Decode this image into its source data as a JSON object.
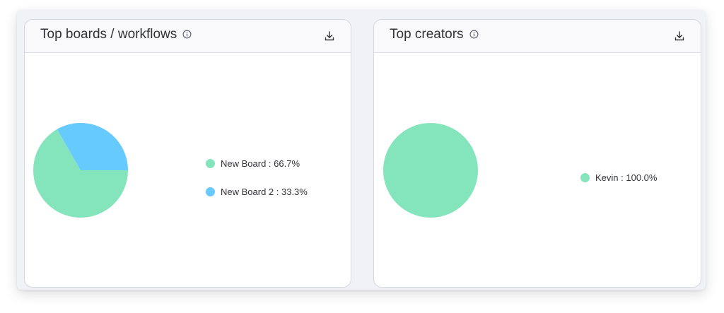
{
  "widgets": [
    {
      "title": "Top boards / workflows",
      "info_icon": "info-icon",
      "download_icon": "download-icon"
    },
    {
      "title": "Top creators",
      "info_icon": "info-icon",
      "download_icon": "download-icon"
    }
  ],
  "colors": {
    "green": "#84e5bd",
    "blue": "#67cafd"
  },
  "chart_data": [
    {
      "type": "pie",
      "title": "Top boards / workflows",
      "categories": [
        "New Board",
        "New Board 2"
      ],
      "values": [
        66.7,
        33.3
      ],
      "colors": [
        "#84e5bd",
        "#67cafd"
      ],
      "legend_labels": [
        "New Board : 66.7%",
        "New Board 2 : 33.3%"
      ],
      "legend": "right"
    },
    {
      "type": "pie",
      "title": "Top creators",
      "categories": [
        "Kevin"
      ],
      "values": [
        100.0
      ],
      "colors": [
        "#84e5bd"
      ],
      "legend_labels": [
        "Kevin : 100.0%"
      ],
      "legend": "right"
    }
  ]
}
